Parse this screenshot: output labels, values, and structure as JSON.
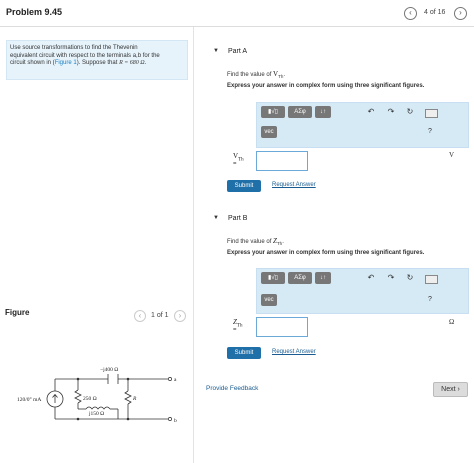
{
  "header": {
    "title": "Problem 9.45",
    "pager": "4 of 16",
    "prev": "‹",
    "next": "›"
  },
  "problem": {
    "line1": "Use source transformations to find the Thevenin",
    "line2": "equivalent circuit with respect to the terminals a,b for the",
    "line3_pre": "circuit shown in (",
    "figure_link": "Figure 1",
    "line3_post": "). Suppose that ",
    "r_value": "R = 680 Ω",
    "period": "."
  },
  "figure": {
    "label": "Figure",
    "pager": "1 of 1",
    "circuit": {
      "source": "120/0° mA",
      "capacitor": "−j400 Ω",
      "resistor_250": "250 Ω",
      "inductor": "j150 Ω",
      "resistor_r": "R",
      "terminal_a": "a",
      "terminal_b": "b"
    }
  },
  "partA": {
    "title": "Part A",
    "question_pre": "Find the value of ",
    "question_var": "V",
    "question_sub": "Th",
    "question_post": ".",
    "instruction": "Express your answer in complex form using three significant figures.",
    "toolbar": {
      "template": "▮√▯",
      "greek": "ΑΣφ",
      "arrows": "↓↑",
      "vec": "vec",
      "help": "?"
    },
    "var_label": "V",
    "var_sub": "Th",
    "equals": "=",
    "unit": "V",
    "submit": "Submit",
    "request": "Request Answer"
  },
  "partB": {
    "title": "Part B",
    "question_pre": "Find the value of ",
    "question_var": "Z",
    "question_sub": "Th",
    "question_post": ".",
    "instruction": "Express your answer in complex form using three significant figures.",
    "toolbar": {
      "template": "▮√▯",
      "greek": "ΑΣφ",
      "arrows": "↓↑",
      "vec": "vec",
      "help": "?"
    },
    "var_label": "Z",
    "var_sub": "Th",
    "equals": "=",
    "unit": "Ω",
    "submit": "Submit",
    "request": "Request Answer"
  },
  "footer": {
    "feedback": "Provide Feedback",
    "next": "Next ›"
  },
  "colors": {
    "accent": "#1f6fa8",
    "panel": "#e6f3fb",
    "toolbar": "#d6eaf6"
  }
}
